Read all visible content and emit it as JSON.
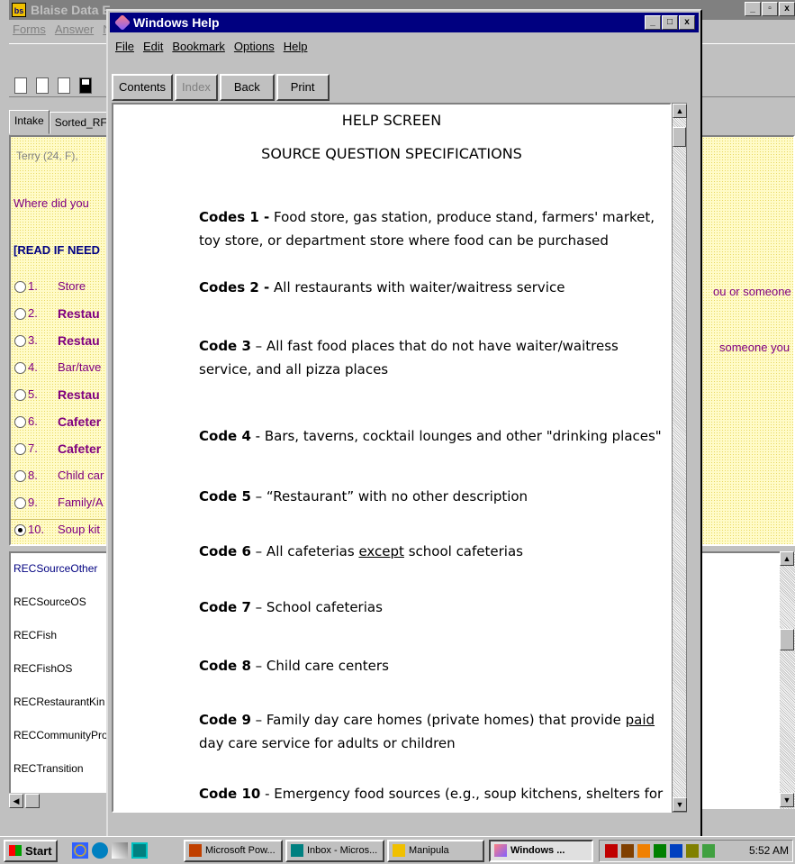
{
  "blaise": {
    "title": "Blaise Data E",
    "menu": [
      "Forms",
      "Answer",
      "N"
    ],
    "tabs": [
      "Intake",
      "Sorted_RF"
    ],
    "respondent": "Terry (24, F),",
    "question_text": "Where did you",
    "instruction": "[READ IF NEED",
    "answers": [
      {
        "num": "1.",
        "label": "Store",
        "bold": false,
        "selected": false
      },
      {
        "num": "2.",
        "label": "Restau",
        "bold": true,
        "selected": false
      },
      {
        "num": "3.",
        "label": "Restau",
        "bold": true,
        "selected": false
      },
      {
        "num": "4.",
        "label": "Bar/tave",
        "bold": false,
        "selected": false
      },
      {
        "num": "5.",
        "label": "Restau",
        "bold": true,
        "selected": false
      },
      {
        "num": "6.",
        "label": "Cafeter",
        "bold": true,
        "selected": false
      },
      {
        "num": "7.",
        "label": "Cafeter",
        "bold": true,
        "selected": false
      },
      {
        "num": "8.",
        "label": "Child car",
        "bold": false,
        "selected": false
      },
      {
        "num": "9.",
        "label": "Family/A",
        "bold": false,
        "selected": false
      },
      {
        "num": "10.",
        "label": "Soup kit",
        "bold": false,
        "selected": true
      }
    ],
    "right_text_1": "ou or someone",
    "right_text_2": "someone you",
    "fields": [
      "RECSourceOther",
      "RECSourceOS",
      "RECFish",
      "RECFishOS",
      "RECRestaurantKin",
      "RECCommunityProg",
      "RECTransition"
    ]
  },
  "help": {
    "title": "Windows Help",
    "menu": [
      "File",
      "Edit",
      "Bookmark",
      "Options",
      "Help"
    ],
    "buttons": [
      {
        "label": "Contents",
        "enabled": true
      },
      {
        "label": "Index",
        "enabled": false
      },
      {
        "label": "Back",
        "enabled": true
      },
      {
        "label": "Print",
        "enabled": true
      }
    ],
    "heading1": "HELP SCREEN",
    "heading2": "SOURCE QUESTION SPECIFICATIONS",
    "codes": [
      {
        "key": "Codes 1 -",
        "text": " Food store, gas station, produce stand, farmers' market, toy store, or department store where food can be purchased"
      },
      {
        "key": "Codes 2 -",
        "text": " All restaurants with waiter/waitress service"
      },
      {
        "key": "Code 3",
        "text": " – All fast food places that do not have waiter/waitress service, and all pizza places"
      },
      {
        "key": "Code 4",
        "text": " - Bars, taverns, cocktail lounges and other \"drinking places\""
      },
      {
        "key": "Code 5",
        "text": " – “Restaurant” with no other description"
      },
      {
        "key": "Code 6",
        "pre": " – All cafeterias ",
        "under": "except",
        "post": " school cafeterias"
      },
      {
        "key": "Code 7",
        "text": " – School cafeterias"
      },
      {
        "key": "Code 8",
        "text": " – Child care centers"
      },
      {
        "key": "Code 9",
        "pre": " – Family day care homes (private homes) that provide ",
        "under": "paid",
        "post": " day care service for adults or children"
      },
      {
        "key": "Code 10",
        "text": " - Emergency food sources (e.g., soup kitchens, shelters for"
      }
    ]
  },
  "taskbar": {
    "start": "Start",
    "tasks": [
      "Microsoft Pow...",
      "Inbox - Micros...",
      "Manipula",
      "Windows ..."
    ],
    "clock": "5:52 AM"
  },
  "colors": {
    "help_title": "#000080",
    "question_purple": "#800080",
    "instruction_navy": "#000080"
  }
}
